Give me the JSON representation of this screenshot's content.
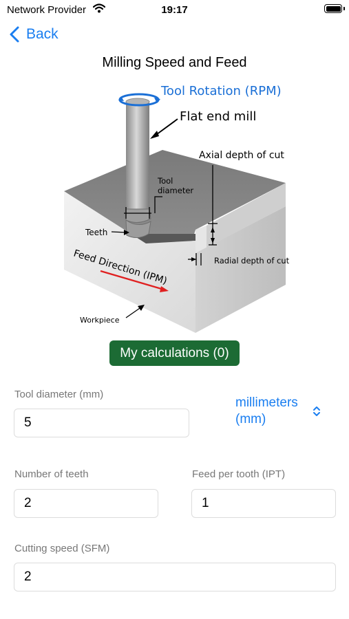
{
  "status_bar": {
    "carrier": "Network Provider",
    "time": "19:17"
  },
  "nav": {
    "back_label": "Back"
  },
  "page": {
    "title": "Milling Speed and Feed"
  },
  "diagram": {
    "tool_rotation": "Tool Rotation (RPM)",
    "flat_end_mill": "Flat end mill",
    "axial_depth": "Axial depth of cut",
    "tool_diameter_line1": "Tool",
    "tool_diameter_line2": "diameter",
    "teeth": "Teeth",
    "feed_direction": "Feed Direction (IPM)",
    "radial_depth": "Radial depth of cut",
    "workpiece": "Workpiece"
  },
  "buttons": {
    "my_calculations": "My calculations (0)"
  },
  "form": {
    "tool_diameter": {
      "label": "Tool diameter (mm)",
      "value": "5"
    },
    "unit": {
      "line1": "millimeters",
      "line2": "(mm)"
    },
    "number_of_teeth": {
      "label": "Number of teeth",
      "value": "2"
    },
    "feed_per_tooth": {
      "label": "Feed per tooth (IPT)",
      "value": "1"
    },
    "cutting_speed": {
      "label": "Cutting speed (SFM)",
      "value": "2"
    }
  },
  "colors": {
    "accent": "#1a7ef0",
    "button_green": "#1c6b34",
    "feed_arrow": "#e02020"
  }
}
